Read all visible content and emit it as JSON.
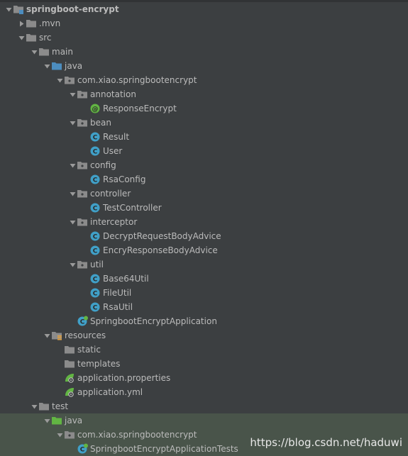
{
  "tree": [
    {
      "label": "springboot-encrypt",
      "depth": 0,
      "expanded": true,
      "icon": "module-folder-icon",
      "bold": true
    },
    {
      "label": ".mvn",
      "depth": 1,
      "expanded": false,
      "icon": "folder-icon"
    },
    {
      "label": "src",
      "depth": 1,
      "expanded": true,
      "icon": "folder-icon"
    },
    {
      "label": "main",
      "depth": 2,
      "expanded": true,
      "icon": "folder-icon"
    },
    {
      "label": "java",
      "depth": 3,
      "expanded": true,
      "icon": "source-folder-icon"
    },
    {
      "label": "com.xiao.springbootencrypt",
      "depth": 4,
      "expanded": true,
      "icon": "package-icon"
    },
    {
      "label": "annotation",
      "depth": 5,
      "expanded": true,
      "icon": "package-icon"
    },
    {
      "label": "ResponseEncrypt",
      "depth": 6,
      "icon": "annotation-icon"
    },
    {
      "label": "bean",
      "depth": 5,
      "expanded": true,
      "icon": "package-icon"
    },
    {
      "label": "Result",
      "depth": 6,
      "icon": "class-icon"
    },
    {
      "label": "User",
      "depth": 6,
      "icon": "class-icon"
    },
    {
      "label": "config",
      "depth": 5,
      "expanded": true,
      "icon": "package-icon"
    },
    {
      "label": "RsaConfig",
      "depth": 6,
      "icon": "class-icon"
    },
    {
      "label": "controller",
      "depth": 5,
      "expanded": true,
      "icon": "package-icon"
    },
    {
      "label": "TestController",
      "depth": 6,
      "icon": "class-icon"
    },
    {
      "label": "interceptor",
      "depth": 5,
      "expanded": true,
      "icon": "package-icon"
    },
    {
      "label": "DecryptRequestBodyAdvice",
      "depth": 6,
      "icon": "class-icon"
    },
    {
      "label": "EncryResponseBodyAdvice",
      "depth": 6,
      "icon": "class-icon"
    },
    {
      "label": "util",
      "depth": 5,
      "expanded": true,
      "icon": "package-icon"
    },
    {
      "label": "Base64Util",
      "depth": 6,
      "icon": "class-icon"
    },
    {
      "label": "FileUtil",
      "depth": 6,
      "icon": "class-icon"
    },
    {
      "label": "RsaUtil",
      "depth": 6,
      "icon": "class-icon"
    },
    {
      "label": "SpringbootEncryptApplication",
      "depth": 5,
      "icon": "spring-boot-class-icon"
    },
    {
      "label": "resources",
      "depth": 3,
      "expanded": true,
      "icon": "resources-folder-icon"
    },
    {
      "label": "static",
      "depth": 4,
      "icon": "folder-icon"
    },
    {
      "label": "templates",
      "depth": 4,
      "icon": "folder-icon"
    },
    {
      "label": "application.properties",
      "depth": 4,
      "icon": "spring-config-icon"
    },
    {
      "label": "application.yml",
      "depth": 4,
      "icon": "spring-config-icon"
    },
    {
      "label": "test",
      "depth": 2,
      "expanded": true,
      "icon": "folder-icon"
    },
    {
      "label": "java",
      "depth": 3,
      "expanded": true,
      "icon": "test-source-folder-icon",
      "test": true
    },
    {
      "label": "com.xiao.springbootencrypt",
      "depth": 4,
      "expanded": true,
      "icon": "package-icon",
      "test": true
    },
    {
      "label": "SpringbootEncryptApplicationTests",
      "depth": 5,
      "icon": "spring-boot-class-icon",
      "test": true
    }
  ],
  "watermark": "https://blog.csdn.net/haduwi",
  "colors": {
    "background": "#3c3f41",
    "text": "#bbbbbb",
    "folder": "#8b8b8b",
    "source_folder": "#4c8dbf",
    "test_folder": "#62b543",
    "class": "#40a0c8",
    "annotation": "#62b543",
    "test_highlight": "#49544a"
  }
}
